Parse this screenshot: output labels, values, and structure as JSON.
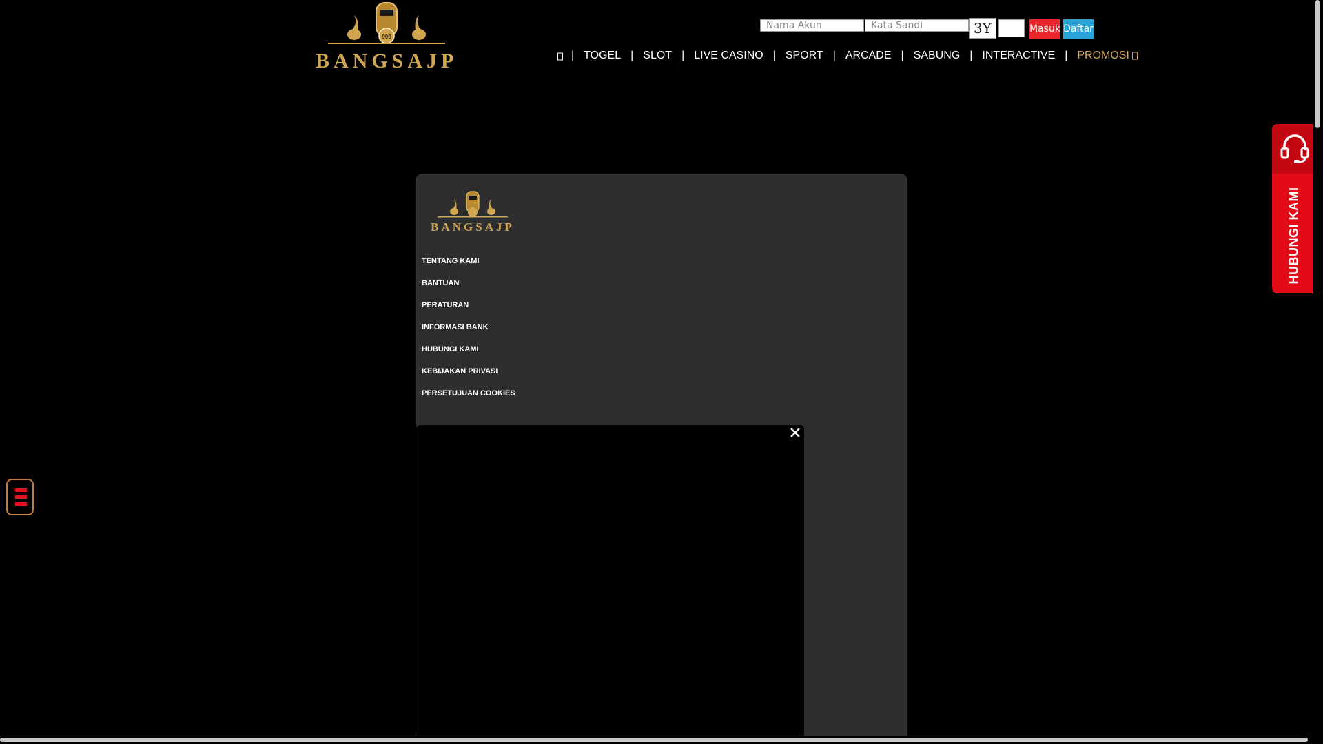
{
  "header": {
    "logo_text": "BANGSAJP"
  },
  "login": {
    "username_placeholder": "Nama Akun",
    "password_placeholder": "Kata Sandi",
    "captcha_text": "3Y",
    "login_label": "Masuk",
    "register_label": "Daftar"
  },
  "nav": {
    "items": [
      {
        "label": "TOGEL"
      },
      {
        "label": "SLOT"
      },
      {
        "label": "LIVE CASINO"
      },
      {
        "label": "SPORT"
      },
      {
        "label": "ARCADE"
      },
      {
        "label": "SABUNG"
      },
      {
        "label": "INTERACTIVE"
      },
      {
        "label": "PROMOSI"
      }
    ],
    "separator": "|"
  },
  "footer": {
    "logo_text": "BANGSAJP",
    "links": [
      {
        "label": "TENTANG KAMI"
      },
      {
        "label": "BANTUAN"
      },
      {
        "label": "PERATURAN"
      },
      {
        "label": "INFORMASI BANK"
      },
      {
        "label": "HUBUNGI KAMI"
      },
      {
        "label": "KEBIJAKAN PRIVASI"
      },
      {
        "label": "PERSETUJUAN COOKIES"
      }
    ]
  },
  "contact": {
    "label": "HUBUNGI KAMI"
  },
  "colors": {
    "background": "#000000",
    "gold": "#d2a651",
    "login_button": "#e8262b",
    "register_button": "#28a3d8",
    "contact_red": "#e30b17",
    "panel": "#2e2e2e"
  },
  "icons": {
    "home": "home-icon",
    "promo": "gift-icon",
    "close": "close-icon",
    "contact": "headset-icon",
    "menu": "hamburger-menu-icon"
  }
}
